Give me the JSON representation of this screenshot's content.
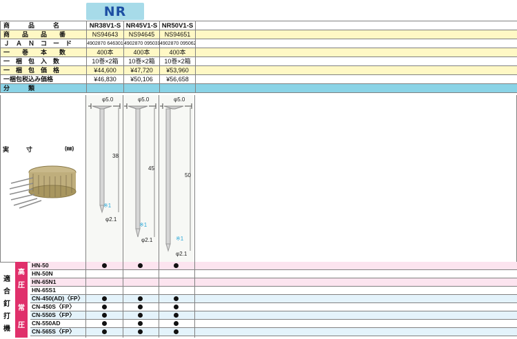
{
  "series_tag": "NR",
  "rows": {
    "product_name": {
      "label": "商　　　品　　　名",
      "values": [
        "NR38V1-S",
        "NR45V1-S",
        "NR50V1-S"
      ]
    },
    "product_code": {
      "label": "商　　品　　品　　番",
      "values": [
        "NS94643",
        "NS94645",
        "NS94651"
      ]
    },
    "jan": {
      "label": "Ｊ　Ａ　Ｎ　コ　ー　ド",
      "values": [
        "4902870 646301",
        "4902870 095031",
        "4902870 095062"
      ]
    },
    "per_roll": {
      "label": "一　　巻　　本　　数",
      "values": [
        "400本",
        "400本",
        "400本"
      ]
    },
    "pack": {
      "label": "一　梱　包　入　数",
      "values": [
        "10巻×2箱",
        "10巻×2箱",
        "10巻×2箱"
      ]
    },
    "price": {
      "label": "一　梱　包　価　格",
      "values": [
        "¥44,600",
        "¥47,720",
        "¥53,960"
      ]
    },
    "price_tax": {
      "label": "一梱包税込み価格",
      "values": [
        "¥46,830",
        "¥50,106",
        "¥56,658"
      ]
    },
    "classification": {
      "label": "分　　　類"
    }
  },
  "figure": {
    "label": "実　寸",
    "unit": "(㎜)",
    "nails": [
      {
        "head": "φ5.0",
        "length": "38",
        "shank": "φ2.1",
        "note": "※1"
      },
      {
        "head": "φ5.0",
        "length": "45",
        "shank": "φ2.1",
        "note": "※1"
      },
      {
        "head": "φ5.0",
        "length": "50",
        "shank": "φ2.1",
        "note": "※1"
      }
    ]
  },
  "machines": {
    "side_label": [
      "適",
      "合",
      "釘",
      "打",
      "機"
    ],
    "high_pressure": {
      "label": [
        "高",
        "圧"
      ],
      "items": [
        {
          "name": "HN-50",
          "fits": [
            true,
            true,
            true
          ]
        },
        {
          "name": "HN-50N",
          "fits": [
            false,
            false,
            false
          ]
        },
        {
          "name": "HN-65N1",
          "fits": [
            false,
            false,
            false
          ]
        },
        {
          "name": "HN-65S1",
          "fits": [
            false,
            false,
            false
          ]
        }
      ]
    },
    "normal_pressure": {
      "label": [
        "常",
        "圧"
      ],
      "items": [
        {
          "name": "CN-450(AD)〈FP〉",
          "fits": [
            true,
            true,
            true
          ]
        },
        {
          "name": "CN-450S〈FP〉",
          "fits": [
            true,
            true,
            true
          ]
        },
        {
          "name": "CN-550S〈FP〉",
          "fits": [
            true,
            true,
            true
          ]
        },
        {
          "name": "CN-550AD",
          "fits": [
            true,
            true,
            true
          ]
        },
        {
          "name": "CN-565S〈FP〉",
          "fits": [
            true,
            true,
            true
          ]
        }
      ]
    }
  },
  "colors": {
    "header_blue": "#8ad3e6",
    "cream": "#fff8c5",
    "high_red": "#e0306b",
    "pink": "#fce4ef"
  }
}
